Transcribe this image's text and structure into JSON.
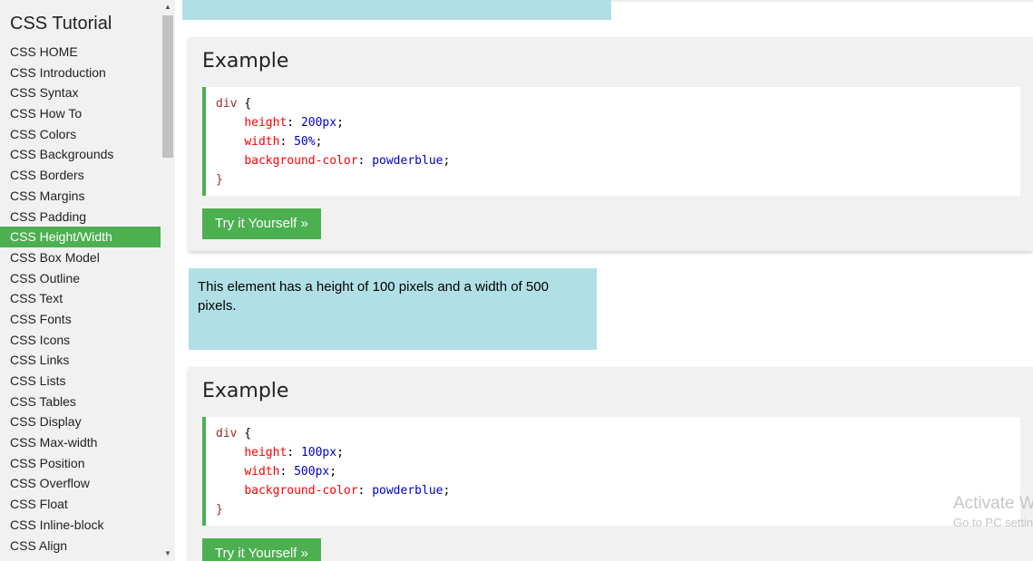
{
  "sidebar": {
    "title": "CSS Tutorial",
    "items": [
      {
        "label": "CSS HOME"
      },
      {
        "label": "CSS Introduction"
      },
      {
        "label": "CSS Syntax"
      },
      {
        "label": "CSS How To"
      },
      {
        "label": "CSS Colors"
      },
      {
        "label": "CSS Backgrounds"
      },
      {
        "label": "CSS Borders"
      },
      {
        "label": "CSS Margins"
      },
      {
        "label": "CSS Padding"
      },
      {
        "label": "CSS Height/Width"
      },
      {
        "label": "CSS Box Model"
      },
      {
        "label": "CSS Outline"
      },
      {
        "label": "CSS Text"
      },
      {
        "label": "CSS Fonts"
      },
      {
        "label": "CSS Icons"
      },
      {
        "label": "CSS Links"
      },
      {
        "label": "CSS Lists"
      },
      {
        "label": "CSS Tables"
      },
      {
        "label": "CSS Display"
      },
      {
        "label": "CSS Max-width"
      },
      {
        "label": "CSS Position"
      },
      {
        "label": "CSS Overflow"
      },
      {
        "label": "CSS Float"
      },
      {
        "label": "CSS Inline-block"
      },
      {
        "label": "CSS Align"
      }
    ],
    "active_label": "CSS Height/Width",
    "scroll_up_icon": "▲",
    "scroll_down_icon": "▼"
  },
  "examples": [
    {
      "heading": "Example",
      "selector": "div",
      "open_brace": " {",
      "close_brace": "}",
      "lines": [
        {
          "prop": "height",
          "value": "200px"
        },
        {
          "prop": "width",
          "value": "50%"
        },
        {
          "prop": "background-color",
          "value": "powderblue"
        }
      ],
      "button_label": "Try it Yourself »"
    },
    {
      "heading": "Example",
      "selector": "div",
      "open_brace": " {",
      "close_brace": "}",
      "lines": [
        {
          "prop": "height",
          "value": "100px"
        },
        {
          "prop": "width",
          "value": "500px"
        },
        {
          "prop": "background-color",
          "value": "powderblue"
        }
      ],
      "button_label": "Try it Yourself »"
    }
  ],
  "demo_text": "This element has a height of 100 pixels and a width of 500 pixels.",
  "watermark": {
    "title": "Activate Windows",
    "subtitle": "Go to PC settings to activate Windows."
  },
  "colors": {
    "accent": "#4CAF50",
    "demo_background": "#b0e0e6",
    "panel_background": "#f1f1f1"
  }
}
